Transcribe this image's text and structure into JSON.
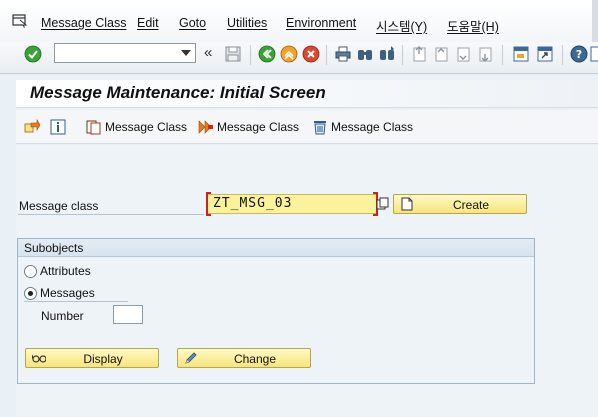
{
  "menubar": {
    "items": [
      {
        "label": "Message Class"
      },
      {
        "label": "Edit"
      },
      {
        "label": "Goto"
      },
      {
        "label": "Utilities"
      },
      {
        "label": "Environment"
      },
      {
        "label": "시스템(Y)"
      },
      {
        "label": "도움말(H)"
      }
    ]
  },
  "toolbar": {
    "command_value": "",
    "icons": [
      "enter-icon",
      "command-field",
      "back-arrows-icon",
      "save-icon",
      "back-icon",
      "exit-icon",
      "cancel-icon",
      "print-icon",
      "find-icon",
      "find-next-icon",
      "first-page-icon",
      "previous-page-icon",
      "next-page-icon",
      "last-page-icon",
      "new-session-icon",
      "shortcut-icon",
      "help-icon"
    ]
  },
  "title": "Message Maintenance: Initial Screen",
  "app_toolbar": {
    "btn_copy": "Message Class",
    "btn_rename": "Message Class",
    "btn_delete": "Message Class"
  },
  "form": {
    "message_class_label": "Message class",
    "message_class_value": "ZT_MSG_03",
    "create_label": "Create"
  },
  "subobjects": {
    "title": "Subobjects",
    "attributes_label": "Attributes",
    "messages_label": "Messages",
    "number_label": "Number",
    "number_value": "",
    "selected": "Messages"
  },
  "buttons": {
    "display_label": "Display",
    "change_label": "Change"
  },
  "colors": {
    "background": "#eef3f8",
    "button_yellow": "#f7e57a",
    "input_yellow": "#fbf39b",
    "required_red": "#d0211e"
  }
}
